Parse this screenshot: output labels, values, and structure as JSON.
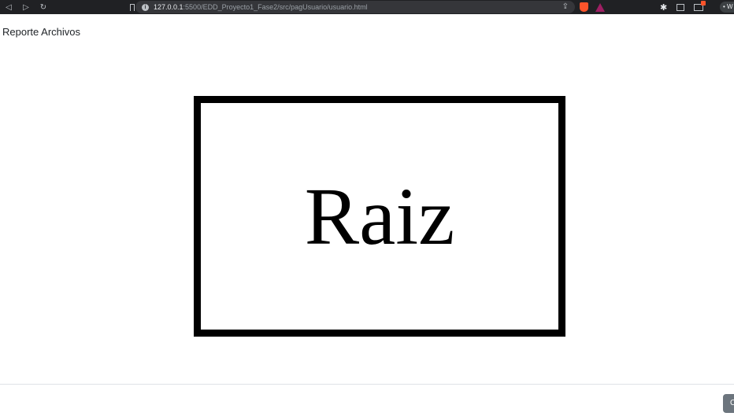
{
  "browser": {
    "url_host": "127.0.0.1",
    "url_rest": ":5500/EDD_Proyecto1_Fase2/src/pagUsuario/usuario.html",
    "profile_label": "• W"
  },
  "page": {
    "title": "Reporte Archivos",
    "graph_node_label": "Raiz",
    "footer_button_label": "C"
  },
  "icons": {
    "back": "back-arrow-icon",
    "forward": "forward-arrow-icon",
    "reload": "reload-icon",
    "bookmark": "bookmark-icon",
    "site_info": "info-icon",
    "share": "share-icon",
    "brave": "brave-shield-icon",
    "rewards": "brave-rewards-icon",
    "extensions": "puzzle-icon",
    "sidebar": "sidebar-icon",
    "wallet": "wallet-icon"
  },
  "colors": {
    "toolbar": "#202124",
    "address_bar": "#35363a",
    "brave": "#fb542b",
    "rewards": "#9e1f63",
    "footer_button": "#6c757d"
  }
}
